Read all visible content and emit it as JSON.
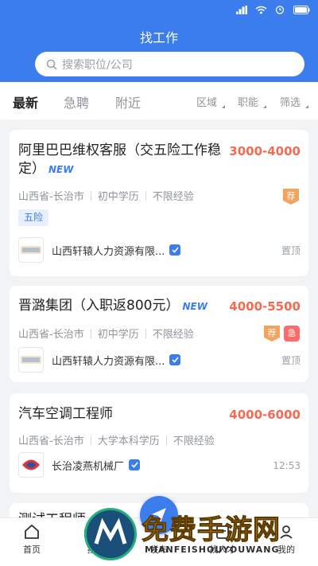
{
  "header": {
    "title": "找工作"
  },
  "search": {
    "placeholder": "搜索职位/公司"
  },
  "tabs": [
    {
      "label": "最新",
      "active": true
    },
    {
      "label": "急聘",
      "active": false
    },
    {
      "label": "附近",
      "active": false
    }
  ],
  "filters": [
    {
      "label": "区域"
    },
    {
      "label": "职能"
    },
    {
      "label": "筛选"
    }
  ],
  "jobs": [
    {
      "title_line1": "阿里巴巴维权客服（交五险工作稳",
      "title_line2": "定）",
      "new_tag": "NEW",
      "salary": "3000-4000",
      "location": "山西省-长治市",
      "education": "初中学历",
      "experience": "不限经验",
      "welfare": "五险",
      "badges": [
        "荐"
      ],
      "company": "山西轩辕人力资源有限...",
      "right_meta": "置顶"
    },
    {
      "title_line1": "晋潞集团（入职返800元）",
      "new_tag": "NEW",
      "salary": "4000-5500",
      "location": "山西省-长治市",
      "education": "初中学历",
      "experience": "不限经验",
      "badges": [
        "荐",
        "急"
      ],
      "company": "山西轩辕人力资源有限...",
      "right_meta": "置顶"
    },
    {
      "title_line1": "汽车空调工程师",
      "salary": "4000-6000",
      "location": "山西省-长治市",
      "education": "大学本科学历",
      "experience": "不限经验",
      "company": "长治凌燕机械厂",
      "right_meta": "12:53"
    },
    {
      "title_line1": "测试工程师"
    }
  ],
  "bottom_nav": [
    {
      "label": "首页",
      "icon": "home-icon"
    },
    {
      "label": "找",
      "icon": "briefcase-icon"
    },
    {
      "label": "发布",
      "icon": "plus-icon"
    },
    {
      "label": "找人才",
      "icon": "people-icon"
    },
    {
      "label": "我的",
      "icon": "user-icon"
    }
  ],
  "watermark": {
    "text": "免费手游网",
    "sub": "MIANFEISHOUYOUWANG"
  },
  "colors": {
    "primary": "#3b7ded",
    "salary": "#f26b52",
    "recommend": "#f5a25d",
    "urgent": "#ff6b6b"
  }
}
